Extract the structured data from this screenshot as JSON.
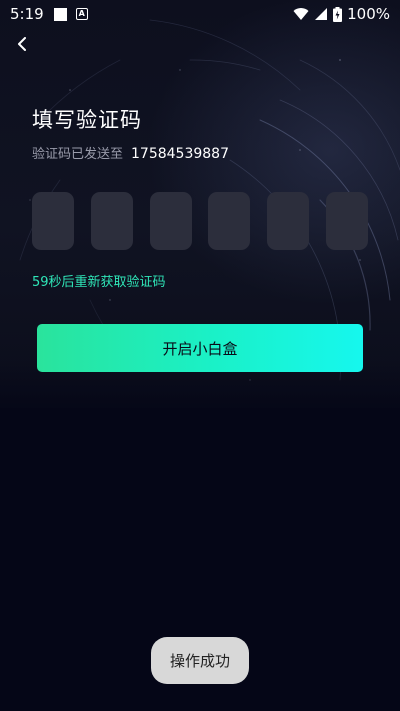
{
  "status_bar": {
    "time": "5:19",
    "battery": "100%",
    "icons": [
      "notification-square-icon",
      "a-badge-icon",
      "wifi-icon",
      "signal-icon",
      "battery-charging-icon"
    ]
  },
  "header": {
    "back_icon": "chevron-left-icon"
  },
  "verify": {
    "title": "填写验证码",
    "sent_label": "验证码已发送至",
    "phone": "17584539887",
    "code_digits": [
      "",
      "",
      "",
      "",
      "",
      ""
    ],
    "resend_text": "59秒后重新获取验证码"
  },
  "actions": {
    "primary_label": "开启小白盒"
  },
  "toast": {
    "text": "操作成功"
  },
  "colors": {
    "accent": "#2fe6b8",
    "button_gradient_start": "#2ae39c",
    "button_gradient_end": "#16f7ee",
    "background": "#050617",
    "code_box": "#2c2e3c"
  }
}
